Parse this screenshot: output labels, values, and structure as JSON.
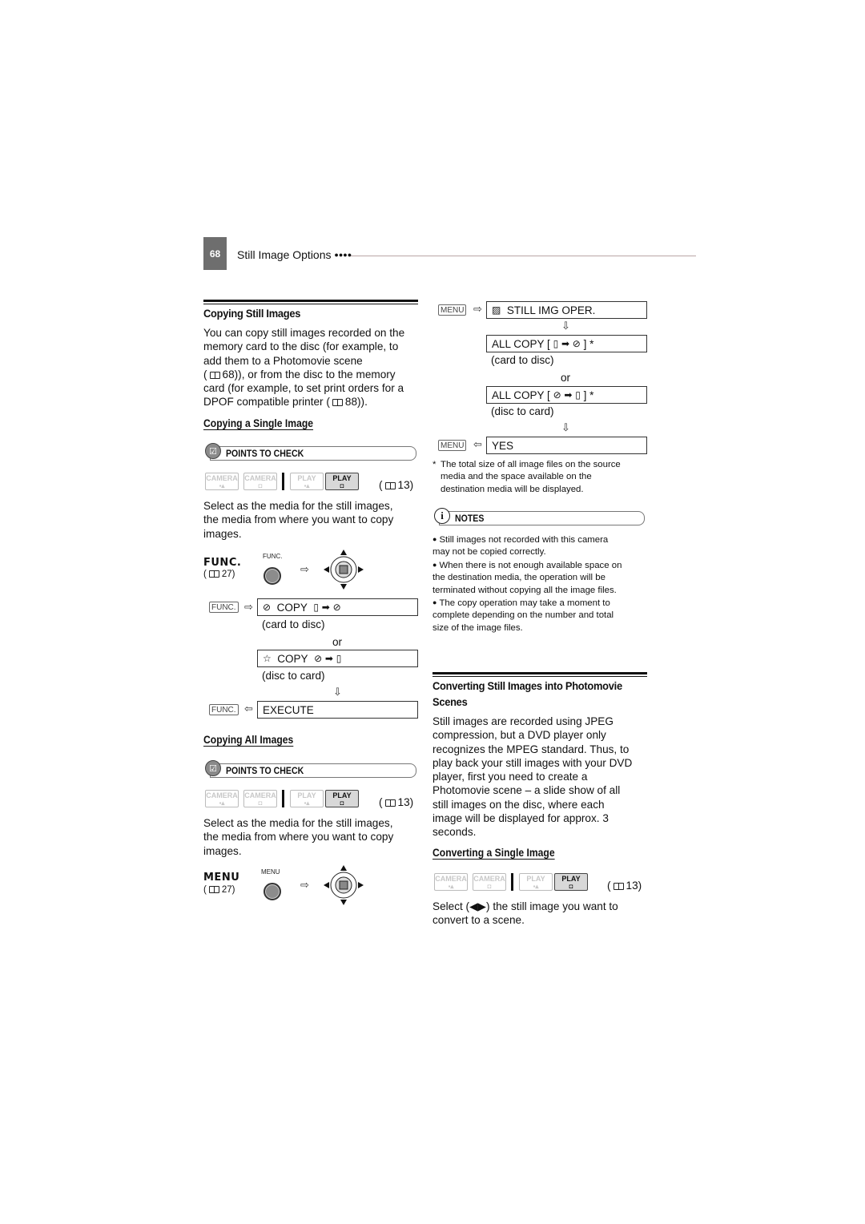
{
  "header": {
    "page_number": "68",
    "running_title": "Still Image Options",
    "running_dots": "●●●●"
  },
  "left": {
    "section_title": "Copying Still Images",
    "intro_lines": [
      "You can copy still images recorded on the",
      "memory card to the disc (for example, to",
      "add them to a Photomovie scene",
      "68)), or from the disc to the memory",
      "card (for example, to set print orders for a",
      "DPOF compatible printer (",
      "88))."
    ],
    "intro_open_paren": "(",
    "single": {
      "title": "Copying a Single Image",
      "points_label": "POINTS TO CHECK",
      "modes": [
        {
          "top": "CAMERA",
          "sub": "🎥",
          "active": false
        },
        {
          "top": "CAMERA",
          "sub": "📷",
          "active": false
        },
        {
          "top": "PLAY",
          "sub": "🎥",
          "active": false
        },
        {
          "top": "PLAY",
          "sub": "📷",
          "active": true
        }
      ],
      "page_ref": "13)",
      "page_ref_open": "(",
      "select_lines": [
        "Select as the media for the still images,",
        "the media from where you want to copy",
        "images."
      ],
      "func_label": "FUNC.",
      "func_ref": "27)",
      "func_ref_open": "(",
      "func_btn_caption": "FUNC.",
      "key_func": "FUNC.",
      "copy1": "COPY",
      "copy1_note": "(card to disc)",
      "or": "or",
      "copy2": "COPY",
      "copy2_note": "(disc to card)",
      "execute": "EXECUTE"
    },
    "all": {
      "title": "Copying All Images",
      "points_label": "POINTS TO CHECK",
      "page_ref": "13)",
      "page_ref_open": "(",
      "select_lines": [
        "Select as the media for the still images,",
        "the media from where you want to copy",
        "images."
      ],
      "menu_label": "MENU",
      "menu_ref": "27)",
      "menu_ref_open": "(",
      "menu_btn_caption": "MENU"
    }
  },
  "right": {
    "key_menu": "MENU",
    "still_img_oper": "STILL IMG OPER.",
    "all_copy_1": "ALL COPY [",
    "all_copy_1_end": "] *",
    "card_to_disc": "(card to disc)",
    "or": "or",
    "all_copy_2": "ALL COPY [",
    "all_copy_2_end": "] *",
    "disc_to_card": "(disc to card)",
    "yes": "YES",
    "footnote_mark": "*",
    "footnote_lines": [
      "The total size of all image files on the source",
      "media and the space available on the",
      "destination media will be displayed."
    ],
    "notes_label": "NOTES",
    "notes": [
      [
        "Still images not recorded with this camera",
        "may not be copied correctly."
      ],
      [
        "When there is not enough available space on",
        "the destination media, the operation will be",
        "terminated without copying all the image files."
      ],
      [
        "The copy operation may take a moment to",
        "complete depending on the number and total",
        "size of the image files."
      ]
    ],
    "convert_title_1": "Converting Still Images into Photomovie",
    "convert_title_2": "Scenes",
    "convert_lines": [
      "Still images are recorded using JPEG",
      "compression, but a DVD player only",
      "recognizes the MPEG standard. Thus, to",
      "play back your still images with your DVD",
      "player, first you need to create a",
      "Photomovie scene – a slide show of all",
      "still images on the disc, where each",
      "image will be displayed for approx. 3",
      "seconds."
    ],
    "convert_single_title": "Converting a Single Image",
    "page_ref": "13)",
    "page_ref_open": "(",
    "select_line_1a": "Select (",
    "select_arrows": "◀▶",
    "select_line_1b": ") the still image you want to",
    "select_line_2": "convert to a scene."
  }
}
